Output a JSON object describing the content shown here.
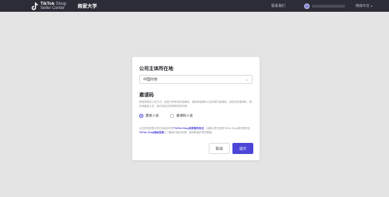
{
  "colors": {
    "topbar_bg": "#2b2c36",
    "overlay_bg": "#e4e4e4",
    "accent": "#4b45d8"
  },
  "header": {
    "logo_icon": "tiktok-note-icon",
    "logo_brand": "TikTok",
    "logo_shop": " Shop",
    "logo_subtitle": "Seller Center",
    "title": "商家大学",
    "feedback_label": "联系我们",
    "user_name": "",
    "language_label": "简体中文"
  },
  "modal": {
    "location": {
      "title": "公司主体所在地",
      "select_value": "中国内地"
    },
    "invite": {
      "title": "邀请码",
      "description": "请选择您的入驻方式。如您已有有效的邀请码，请选择邀请码入驻并填写邀请码，如您没有邀请码，请选择直接入驻，我们将会尽快审核您的申请。",
      "options": [
        "直接入驻",
        "邀请码入驻"
      ],
      "selected": "直接入驻"
    },
    "note_prefix": "点击提交即表示您已阅读并同意",
    "note_link1": "TikTok Shop商家服务协议",
    "note_middle": "，并确认您已知悉TikTok Shop相关规则及",
    "note_link2": "TikTok Shop隐私政策",
    "note_suffix": "以了解我们如何处理、使用和保护您的数据。",
    "cancel_label": "取消",
    "submit_label": "提交"
  }
}
